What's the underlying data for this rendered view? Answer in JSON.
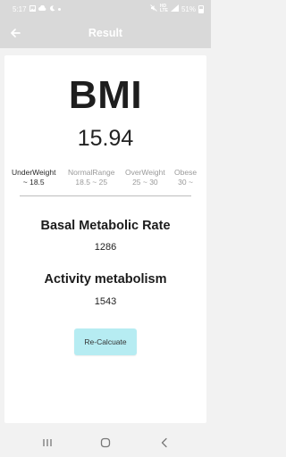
{
  "status_bar": {
    "time": "5:17",
    "battery": "51%"
  },
  "app_bar": {
    "title": "Result"
  },
  "result": {
    "heading": "BMI",
    "value": "15.94",
    "ranges": [
      {
        "name": "UnderWeight",
        "range": "~ 18.5",
        "active": true
      },
      {
        "name": "NormalRange",
        "range": "18.5 ~ 25",
        "active": false
      },
      {
        "name": "OverWeight",
        "range": "25 ~ 30",
        "active": false
      },
      {
        "name": "Obese",
        "range": "30 ~",
        "active": false
      }
    ],
    "bmr_title": "Basal Metabolic Rate",
    "bmr_value": "1286",
    "activity_title": "Activity metabolism",
    "activity_value": "1543",
    "recalc_label": "Re-Calcuate"
  },
  "colors": {
    "bar": "#d9d9d9",
    "button": "#b6ecf2"
  }
}
